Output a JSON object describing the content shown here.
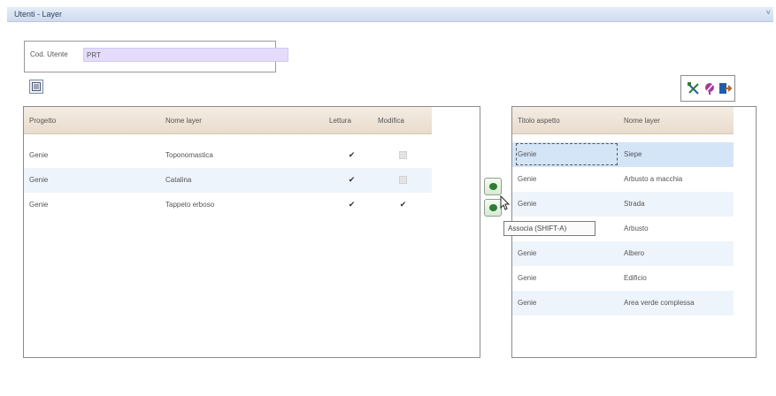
{
  "window": {
    "title": "Utenti - Layer",
    "close_glyph": "˅"
  },
  "user": {
    "label": "Cod. Utente",
    "value": "PRT"
  },
  "left_table": {
    "columns": [
      "Progetto",
      "Nome layer",
      "Lettura",
      "Modifica"
    ],
    "rows": [
      {
        "progetto": "Genie",
        "nome": "Toponomastica",
        "lettura": true,
        "modifica": false
      },
      {
        "progetto": "Genie",
        "nome": "Catalina",
        "lettura": true,
        "modifica": false
      },
      {
        "progetto": "Genie",
        "nome": "Tappeto erboso",
        "lettura": true,
        "modifica": true
      }
    ]
  },
  "right_table": {
    "columns": [
      "Titolo aspetto",
      "Nome layer"
    ],
    "rows": [
      {
        "titolo": "Genie",
        "nome": "Siepe"
      },
      {
        "titolo": "Genie",
        "nome": "Arbusto a macchia"
      },
      {
        "titolo": "Genie",
        "nome": "Strada"
      },
      {
        "titolo": "",
        "nome": "Arbusto"
      },
      {
        "titolo": "Genie",
        "nome": "Albero"
      },
      {
        "titolo": "Genie",
        "nome": "Edificio"
      },
      {
        "titolo": "Genie",
        "nome": "Area verde complessa"
      }
    ]
  },
  "tooltip": "Associa (SHIFT-A)",
  "icons": {
    "assign": "arrow-left-icon",
    "remove": "arrow-right-icon",
    "filter": "filter-icon",
    "tool1": "tools-icon",
    "tool2": "pin-icon",
    "tool3": "exit-icon"
  },
  "colors": {
    "selected_row": "#d5e5f8",
    "header": "#efe4d6",
    "user_input": "#e5dcfb",
    "accent_green": "#2e7d32"
  }
}
